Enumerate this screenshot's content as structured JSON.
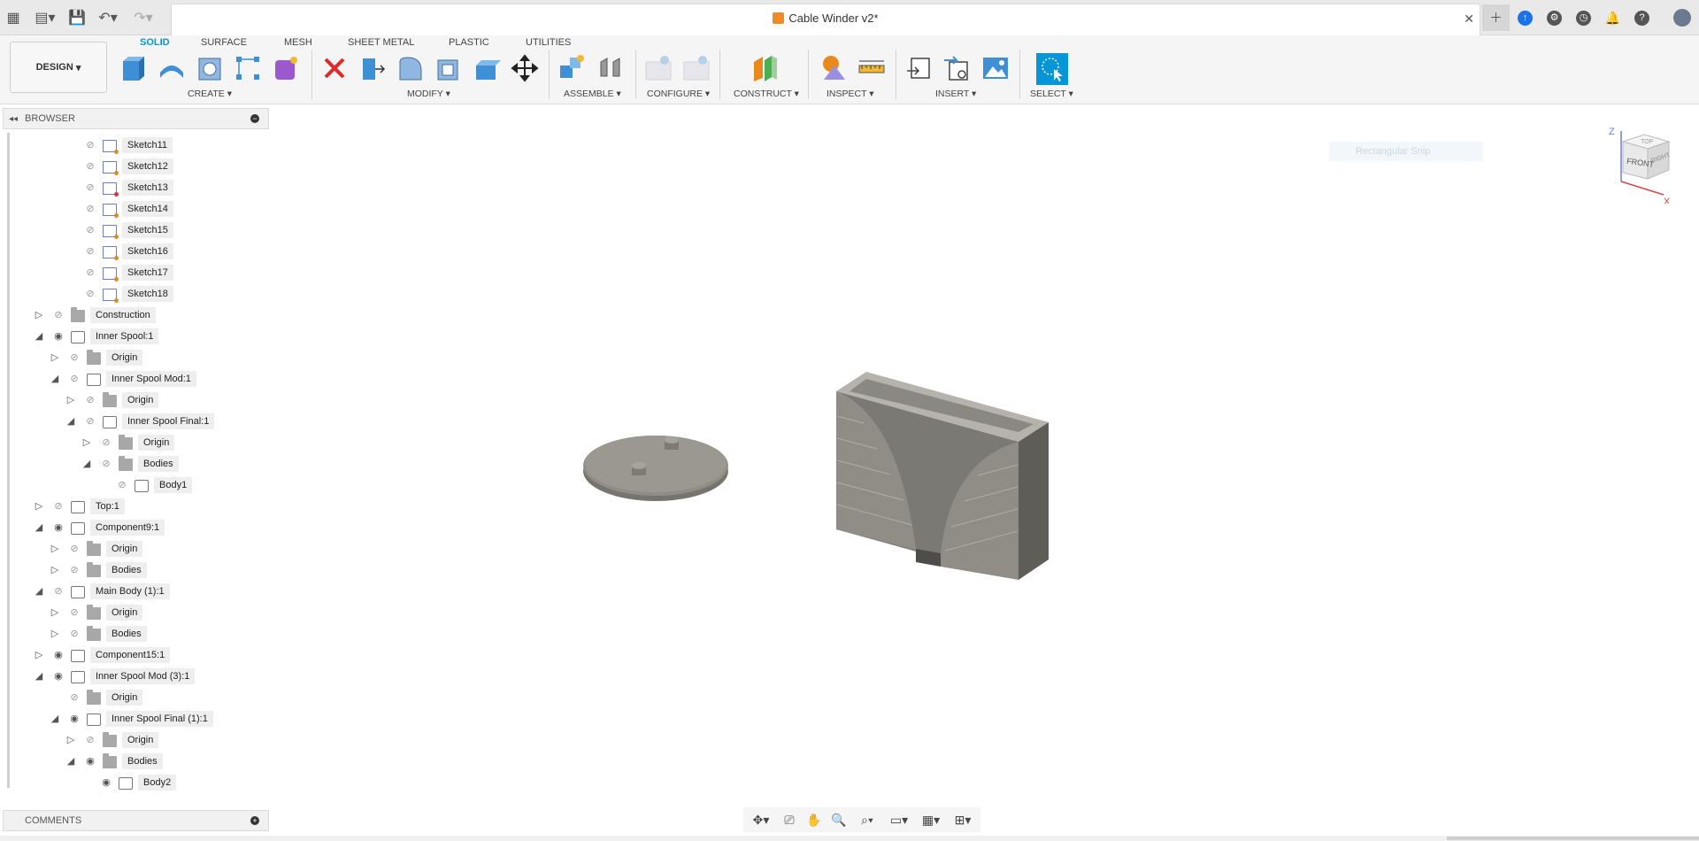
{
  "app": {
    "document_title": "Cable Winder v2*",
    "workspace_button": "DESIGN"
  },
  "ribbon": {
    "tabs": [
      {
        "label": "SOLID",
        "active": true
      },
      {
        "label": "SURFACE"
      },
      {
        "label": "MESH"
      },
      {
        "label": "SHEET METAL"
      },
      {
        "label": "PLASTIC"
      },
      {
        "label": "UTILITIES"
      }
    ],
    "groups": [
      "CREATE",
      "MODIFY",
      "ASSEMBLE",
      "CONFIGURE",
      "CONSTRUCT",
      "INSPECT",
      "INSERT",
      "SELECT"
    ]
  },
  "browser": {
    "label": "BROWSER",
    "nodes": [
      {
        "label": "Sketch11",
        "type": "sketch"
      },
      {
        "label": "Sketch12",
        "type": "sketch"
      },
      {
        "label": "Sketch13",
        "type": "sketch-red"
      },
      {
        "label": "Sketch14",
        "type": "sketch"
      },
      {
        "label": "Sketch15",
        "type": "sketch"
      },
      {
        "label": "Sketch16",
        "type": "sketch"
      },
      {
        "label": "Sketch17",
        "type": "sketch"
      },
      {
        "label": "Sketch18",
        "type": "sketch"
      },
      {
        "label": "Construction",
        "type": "folder"
      },
      {
        "label": "Inner Spool:1",
        "type": "comp"
      },
      {
        "label": "Origin",
        "type": "folder"
      },
      {
        "label": "Inner Spool Mod:1",
        "type": "comp"
      },
      {
        "label": "Origin",
        "type": "folder"
      },
      {
        "label": "Inner Spool Final:1",
        "type": "comp"
      },
      {
        "label": "Origin",
        "type": "folder"
      },
      {
        "label": "Bodies",
        "type": "folder"
      },
      {
        "label": "Body1",
        "type": "body"
      },
      {
        "label": "Top:1",
        "type": "comp"
      },
      {
        "label": "Component9:1",
        "type": "comp"
      },
      {
        "label": "Origin",
        "type": "folder"
      },
      {
        "label": "Bodies",
        "type": "folder"
      },
      {
        "label": "Main Body (1):1",
        "type": "comp"
      },
      {
        "label": "Origin",
        "type": "folder"
      },
      {
        "label": "Bodies",
        "type": "folder"
      },
      {
        "label": "Component15:1",
        "type": "comp"
      },
      {
        "label": "Inner Spool Mod (3):1",
        "type": "comp"
      },
      {
        "label": "Origin",
        "type": "folder"
      },
      {
        "label": "Inner Spool Final (1):1",
        "type": "comp"
      },
      {
        "label": "Origin",
        "type": "folder"
      },
      {
        "label": "Bodies",
        "type": "folder"
      },
      {
        "label": "Body2",
        "type": "body"
      }
    ]
  },
  "comments": {
    "label": "COMMENTS"
  },
  "viewcube": {
    "front": "FRONT",
    "right": "RIGHT",
    "top": "TOP",
    "z": "Z",
    "x": "X"
  },
  "ghost_hint": "Rectangular Snip",
  "colors": {
    "accent": "#0696d7",
    "model": "#8f8d86"
  }
}
